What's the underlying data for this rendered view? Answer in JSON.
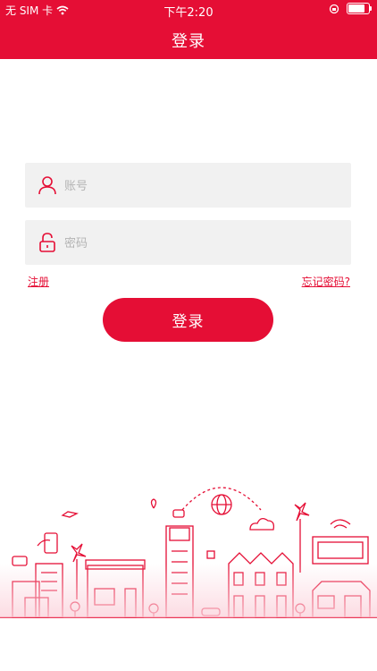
{
  "status_bar": {
    "carrier": "无 SIM 卡",
    "time": "下午2:20",
    "icons": [
      "wifi-icon",
      "orientation-lock-icon",
      "battery-icon"
    ]
  },
  "header": {
    "title": "登录"
  },
  "form": {
    "account_placeholder": "账号",
    "password_placeholder": "密码",
    "register_link": "注册",
    "forgot_link": "忘记密码?",
    "login_button": "登录"
  },
  "colors": {
    "brand_red": "#e50e35",
    "field_bg": "#f1f1f1",
    "placeholder": "#b4b4b4"
  },
  "illustration": {
    "icon": "city-skyline-illustration"
  }
}
